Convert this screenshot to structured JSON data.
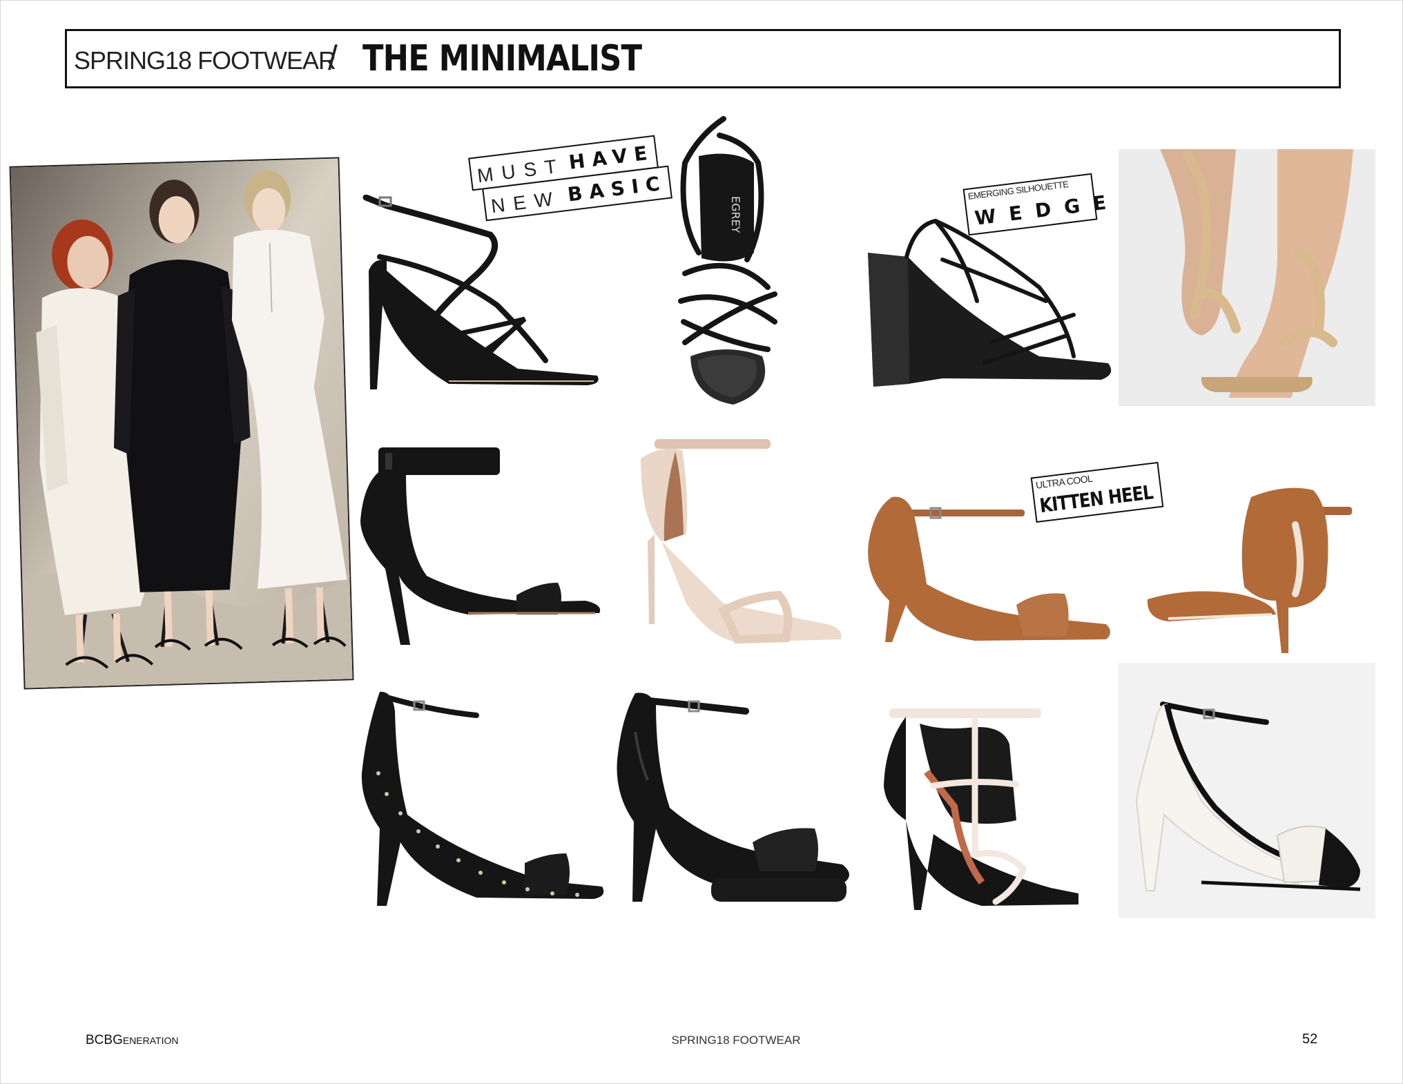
{
  "header": {
    "section": "SPRING18 FOOTWEAR",
    "separator": "/",
    "title": "THE MINIMALIST"
  },
  "tags": {
    "must": {
      "light": "MUST",
      "bold": "HAVE"
    },
    "new": {
      "light": "NEW",
      "bold": "BASIC"
    },
    "wedge": {
      "light": "EMERGING SILHOUETTE",
      "bold": "WEDGE"
    },
    "kitten": {
      "light": "ULTRA COOL",
      "bold": "KITTEN HEEL"
    }
  },
  "products": {
    "top_view_brand_stamp": "EGREY"
  },
  "footer": {
    "brand_main": "BCBG",
    "brand_small": "ENERATION",
    "section": "SPRING18 FOOTWEAR",
    "page": "52"
  },
  "colors": {
    "black_leather": "#151515",
    "nude": "#e9d2c0",
    "tan_suede": "#b26a39",
    "camel": "#d9b98e",
    "white_leather": "#f4f1ec"
  }
}
